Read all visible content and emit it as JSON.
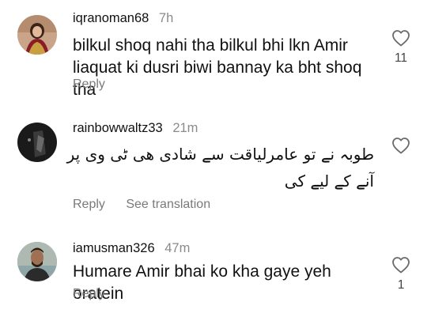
{
  "comments": [
    {
      "username": "iqranoman68",
      "time": "7h",
      "text": "bilkul shoq nahi tha bilkul bhi lkn Amir liaquat ki dusri biwi bannay ka bht shoq tha",
      "actions": [
        "Reply"
      ],
      "likes": "11"
    },
    {
      "username": "rainbowwaltz33",
      "time": "21m",
      "text": "طوبہ نے تو عامرلیاقت سے شادی ھی ٹی وی پر آنے کے لیے کی",
      "actions": [
        "Reply",
        "See translation"
      ],
      "likes": ""
    },
    {
      "username": "iamusman326",
      "time": "47m",
      "text": "Humare Amir bhai ko kha gaye yeh oratein",
      "actions": [
        "Reply"
      ],
      "likes": "1"
    }
  ]
}
